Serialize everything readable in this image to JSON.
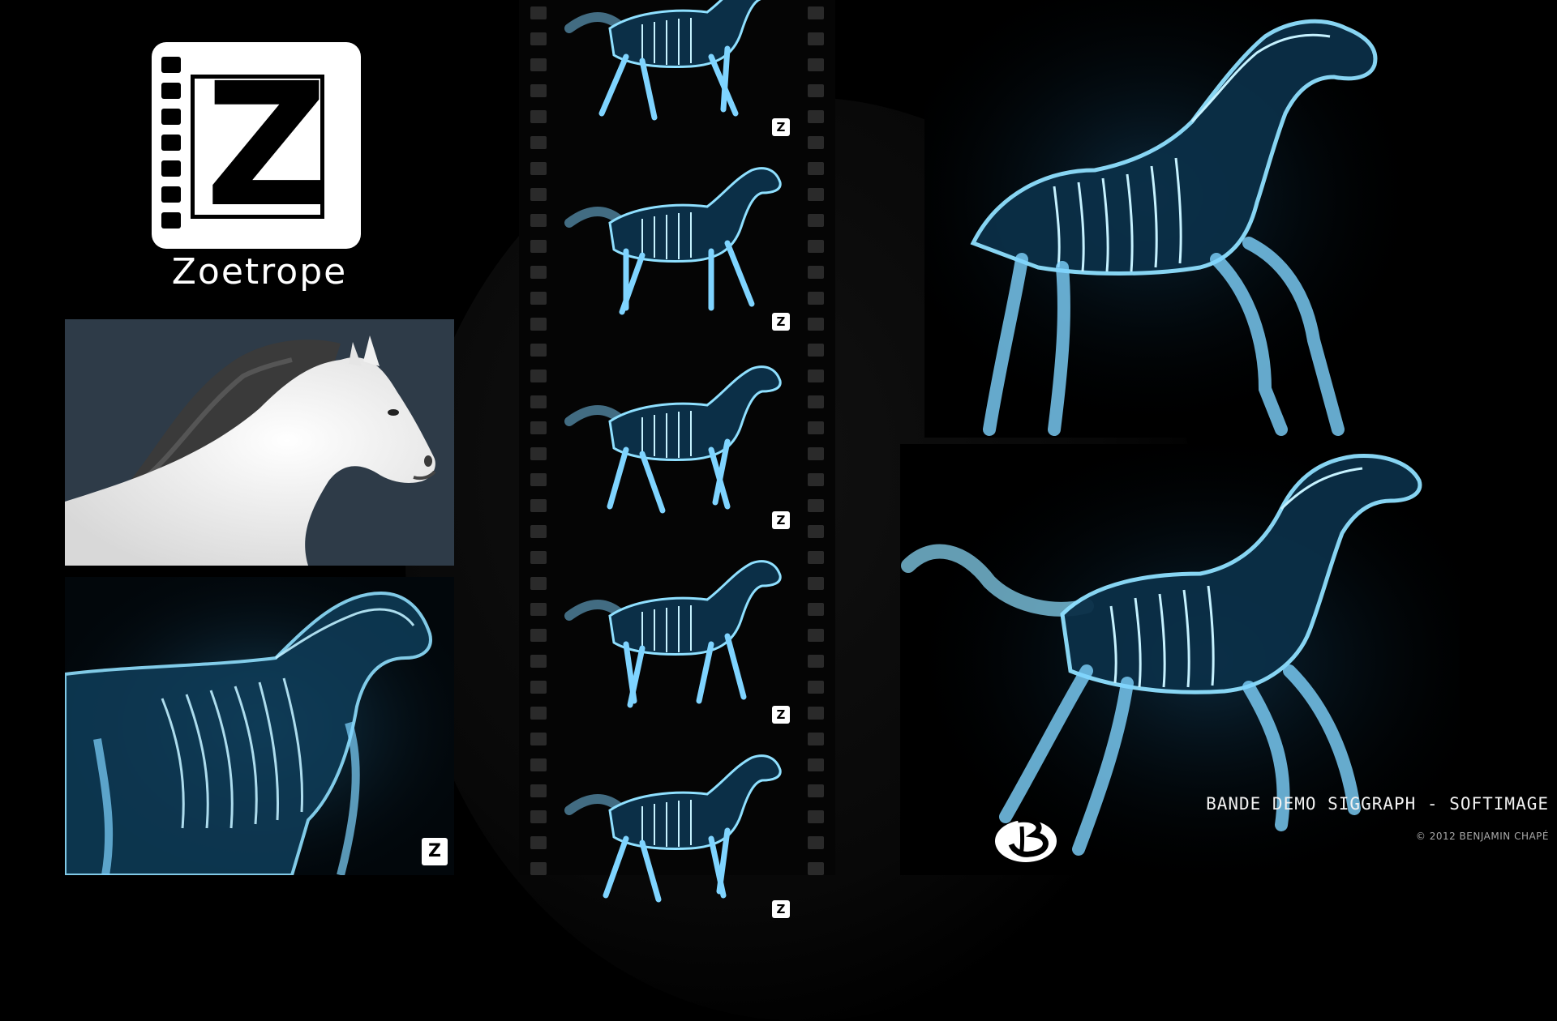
{
  "logo": {
    "glyph": "Z",
    "wordmark": "Zoetrope"
  },
  "film_strip": {
    "frame_count": 5,
    "frame_badge_glyph": "Z"
  },
  "caption": {
    "title": "BANDE DEMO SIGGRAPH - SOFTIMAGE",
    "copyright": "© 2012 BENJAMIN CHAPÉ"
  },
  "colors": {
    "background": "#000000",
    "xray_glow": "#7fd4ff",
    "xray_core": "#1d5a8a",
    "panel_slate": "#2e3b48"
  }
}
